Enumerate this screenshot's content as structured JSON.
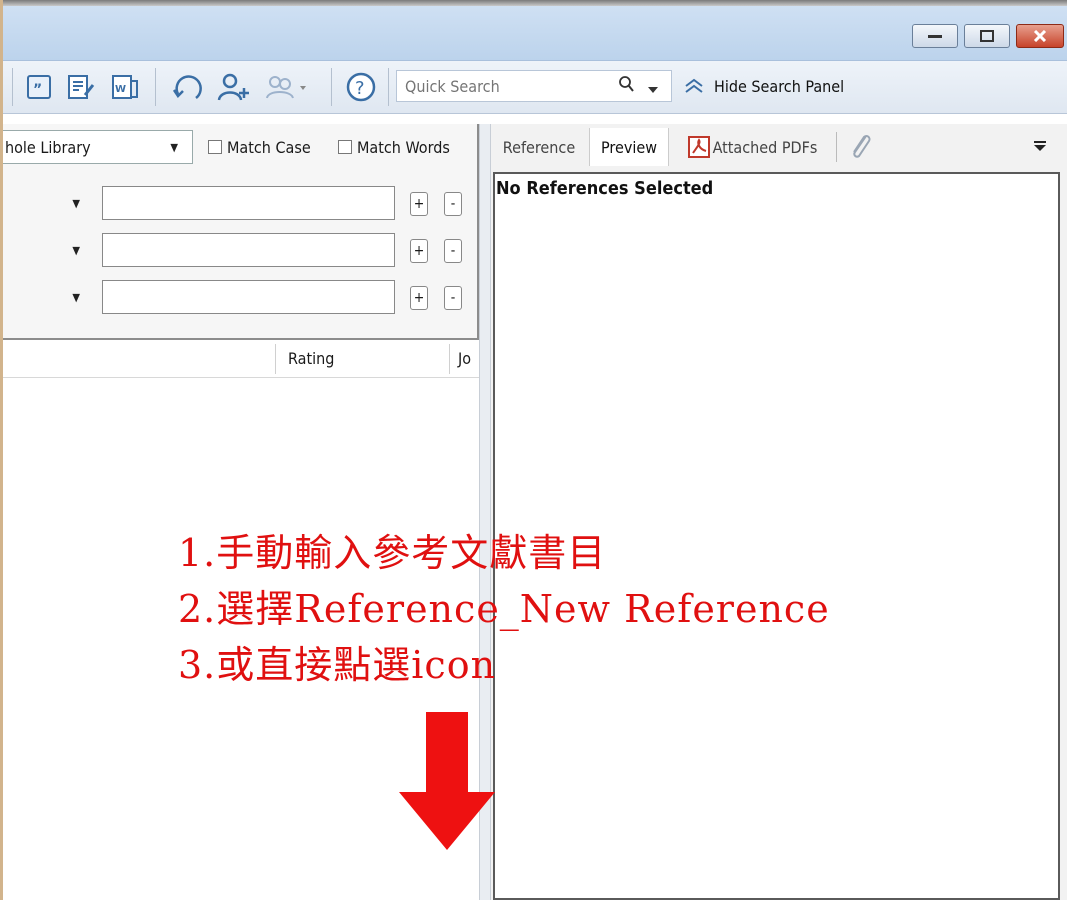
{
  "window": {
    "controls": [
      "minimize",
      "maximize",
      "close"
    ]
  },
  "toolbar": {
    "icons": [
      "quote-icon",
      "edit-reference-icon",
      "word-icon",
      "sync-icon",
      "share-group-icon",
      "shared-users-icon",
      "help-icon"
    ],
    "quick_search_placeholder": "Quick Search",
    "hide_search_panel": "Hide Search Panel"
  },
  "search_panel": {
    "scope": "hole Library",
    "match_case": "Match Case",
    "match_words": "Match Words",
    "plus": "+",
    "minus": "-"
  },
  "reference_list": {
    "columns": [
      "Rating",
      "Jo"
    ]
  },
  "right_panel": {
    "tabs": [
      "Reference",
      "Preview",
      "Attached PDFs"
    ],
    "active_tab": "Preview",
    "status": "No References Selected"
  },
  "annotation": {
    "lines": [
      "1.手動輸入參考文獻書目",
      "2.選擇Reference_New Reference",
      "3.或直接點選icon"
    ],
    "color": "#e01010"
  },
  "colors": {
    "titlebar": "#c5d9ef",
    "arrow": "#ee1111"
  }
}
